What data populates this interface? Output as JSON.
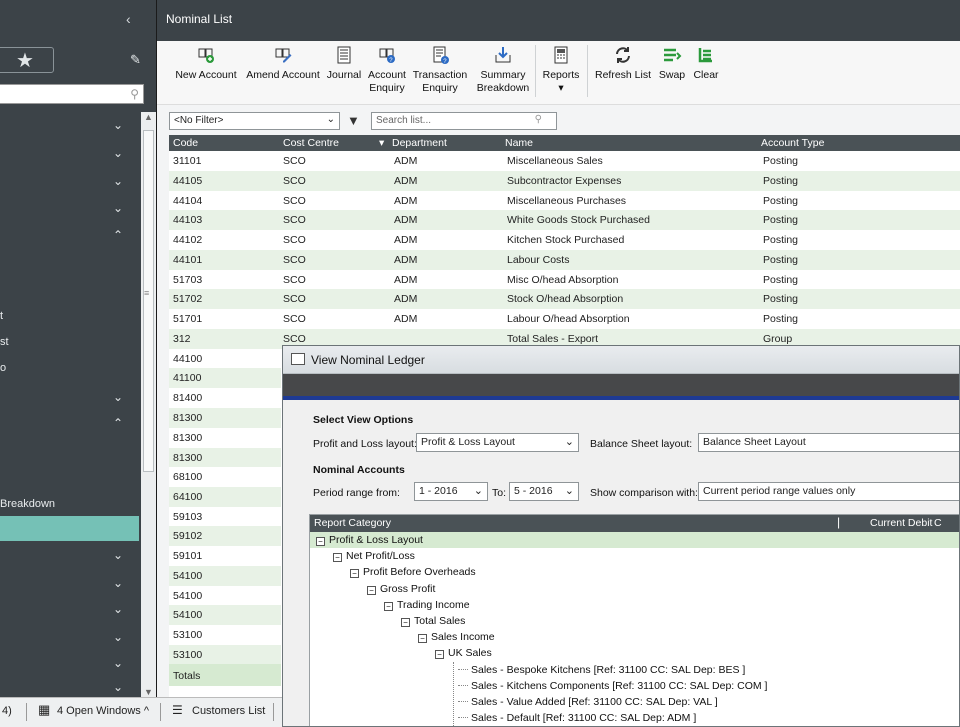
{
  "sidebar": {
    "collapse_icon": "‹",
    "nav_texts": [
      "t",
      "st",
      "o",
      "Breakdown"
    ]
  },
  "window": {
    "title": "Nominal List"
  },
  "toolbar": {
    "new_account": "New Account",
    "amend_account": "Amend Account",
    "journal": "Journal",
    "account_enquiry_1": "Account",
    "account_enquiry_2": "Enquiry",
    "transaction_enquiry_1": "Transaction",
    "transaction_enquiry_2": "Enquiry",
    "summary_breakdown_1": "Summary",
    "summary_breakdown_2": "Breakdown",
    "reports": "Reports",
    "refresh_list": "Refresh List",
    "swap": "Swap",
    "clear": "Clear"
  },
  "filter": {
    "value": "<No Filter>",
    "search_placeholder": "Search list..."
  },
  "grid": {
    "headers": {
      "code": "Code",
      "cost_centre": "Cost Centre",
      "department": "Department",
      "name": "Name",
      "account_type": "Account Type"
    },
    "rows": [
      {
        "code": "31101",
        "cc": "SCO",
        "dept": "ADM",
        "name": "Miscellaneous Sales",
        "type": "Posting"
      },
      {
        "code": "44105",
        "cc": "SCO",
        "dept": "ADM",
        "name": "Subcontractor Expenses",
        "type": "Posting"
      },
      {
        "code": "44104",
        "cc": "SCO",
        "dept": "ADM",
        "name": "Miscellaneous Purchases",
        "type": "Posting"
      },
      {
        "code": "44103",
        "cc": "SCO",
        "dept": "ADM",
        "name": "White Goods Stock Purchased",
        "type": "Posting"
      },
      {
        "code": "44102",
        "cc": "SCO",
        "dept": "ADM",
        "name": "Kitchen Stock Purchased",
        "type": "Posting"
      },
      {
        "code": "44101",
        "cc": "SCO",
        "dept": "ADM",
        "name": "Labour Costs",
        "type": "Posting"
      },
      {
        "code": "51703",
        "cc": "SCO",
        "dept": "ADM",
        "name": "Misc O/head Absorption",
        "type": "Posting"
      },
      {
        "code": "51702",
        "cc": "SCO",
        "dept": "ADM",
        "name": "Stock O/head Absorption",
        "type": "Posting"
      },
      {
        "code": "51701",
        "cc": "SCO",
        "dept": "ADM",
        "name": "Labour O/head Absorption",
        "type": "Posting"
      },
      {
        "code": "312",
        "cc": "SCO",
        "dept": "",
        "name": "Total Sales - Export",
        "type": "Group"
      },
      {
        "code": "44100",
        "cc": "",
        "dept": "",
        "name": "",
        "type": ""
      },
      {
        "code": "41100",
        "cc": "",
        "dept": "",
        "name": "",
        "type": ""
      },
      {
        "code": "81400",
        "cc": "",
        "dept": "",
        "name": "",
        "type": ""
      },
      {
        "code": "81300",
        "cc": "",
        "dept": "",
        "name": "",
        "type": ""
      },
      {
        "code": "81300",
        "cc": "",
        "dept": "",
        "name": "",
        "type": ""
      },
      {
        "code": "81300",
        "cc": "",
        "dept": "",
        "name": "",
        "type": ""
      },
      {
        "code": "68100",
        "cc": "",
        "dept": "",
        "name": "",
        "type": ""
      },
      {
        "code": "64100",
        "cc": "",
        "dept": "",
        "name": "",
        "type": ""
      },
      {
        "code": "59103",
        "cc": "",
        "dept": "",
        "name": "",
        "type": ""
      },
      {
        "code": "59102",
        "cc": "",
        "dept": "",
        "name": "",
        "type": ""
      },
      {
        "code": "59101",
        "cc": "",
        "dept": "",
        "name": "",
        "type": ""
      },
      {
        "code": "54100",
        "cc": "",
        "dept": "",
        "name": "",
        "type": ""
      },
      {
        "code": "54100",
        "cc": "",
        "dept": "",
        "name": "",
        "type": ""
      },
      {
        "code": "54100",
        "cc": "",
        "dept": "",
        "name": "",
        "type": ""
      },
      {
        "code": "53100",
        "cc": "",
        "dept": "",
        "name": "",
        "type": ""
      },
      {
        "code": "53100",
        "cc": "",
        "dept": "",
        "name": "",
        "type": ""
      }
    ],
    "totals_label": "Totals"
  },
  "taskbar": {
    "left_fragment": "4)",
    "open_windows": "4 Open Windows ^",
    "customers_list": "Customers List"
  },
  "dialog": {
    "title": "View Nominal Ledger",
    "select_view_options": "Select View Options",
    "pl_layout_label": "Profit and Loss layout:",
    "pl_layout_value": "Profit & Loss Layout",
    "bs_layout_label": "Balance Sheet layout:",
    "bs_layout_value": "Balance Sheet Layout",
    "nominal_accounts": "Nominal Accounts",
    "period_from_label": "Period range from:",
    "period_from_value": "1 - 2016",
    "to_label": "To:",
    "period_to_value": "5 - 2016",
    "comparison_label": "Show comparison with:",
    "comparison_value": "Current period range values only",
    "tree_headers": {
      "category": "Report Category",
      "current_debit": "Current Debit",
      "next": "C"
    },
    "tree": [
      {
        "label": "Profit & Loss Layout",
        "level": 0,
        "box": true
      },
      {
        "label": "Net Profit/Loss",
        "level": 1,
        "box": true
      },
      {
        "label": "Profit Before Overheads",
        "level": 2,
        "box": true
      },
      {
        "label": "Gross Profit",
        "level": 3,
        "box": true
      },
      {
        "label": "Trading Income",
        "level": 4,
        "box": true
      },
      {
        "label": "Total Sales",
        "level": 5,
        "box": true
      },
      {
        "label": "Sales Income",
        "level": 6,
        "box": true
      },
      {
        "label": "UK Sales",
        "level": 7,
        "box": true
      },
      {
        "label": "Sales - Bespoke Kitchens [Ref: 31100 CC: SAL Dep: BES ]",
        "level": 8,
        "box": false
      },
      {
        "label": "Sales - Kitchens Components [Ref: 31100 CC: SAL Dep: COM ]",
        "level": 8,
        "box": false
      },
      {
        "label": "Sales - Value Added [Ref: 31100 CC: SAL Dep: VAL ]",
        "level": 8,
        "box": false
      },
      {
        "label": "Sales - Default [Ref: 31100 CC: SAL Dep: ADM ]",
        "level": 8,
        "box": false
      }
    ]
  }
}
